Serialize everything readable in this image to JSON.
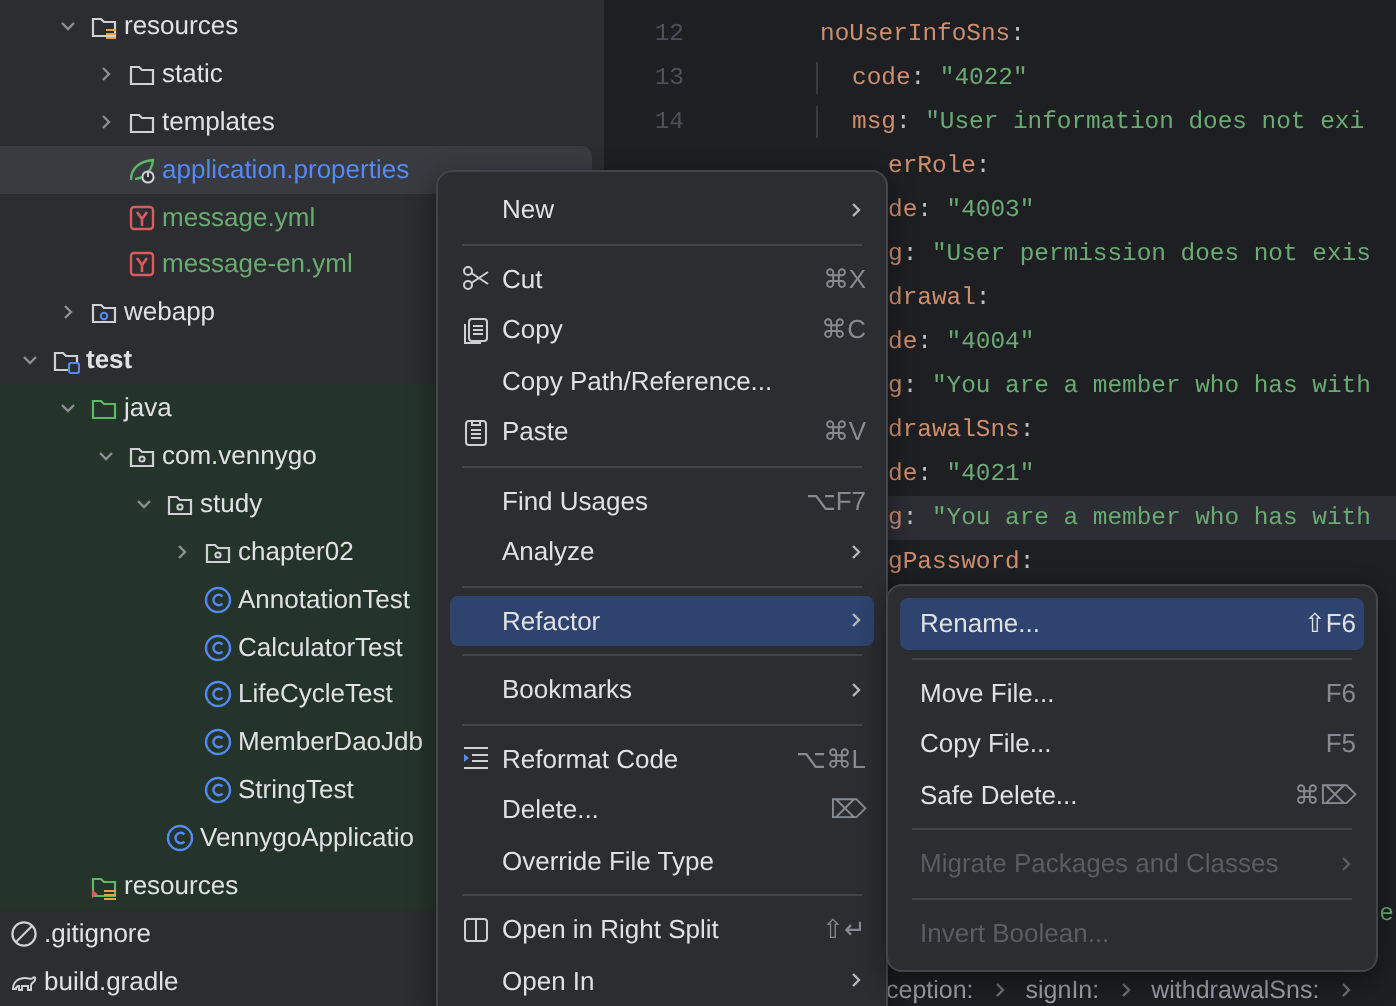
{
  "project_tree": [
    {
      "kind": "offscreen_parent",
      "children": [
        {
          "kind": "offscreen_parent",
          "children": [
            {
              "label": "resources",
              "kind": "resources_folder",
              "expanded": true,
              "selected": false,
              "children": [
                {
                  "label": "static",
                  "kind": "folder",
                  "expanded": false,
                  "selected": false
                },
                {
                  "label": "templates",
                  "kind": "folder",
                  "expanded": false,
                  "selected": false
                },
                {
                  "label": "application.properties",
                  "kind": "spring_config",
                  "color": "#548af7",
                  "selected": true
                },
                {
                  "label": "message.yml",
                  "kind": "yaml",
                  "color": "#6aab73",
                  "selected": false
                },
                {
                  "label": "message-en.yml",
                  "kind": "yaml",
                  "color": "#6aab73",
                  "selected": false
                }
              ]
            },
            {
              "label": "webapp",
              "kind": "web_folder",
              "expanded": false,
              "selected": false
            }
          ]
        },
        {
          "label": "test",
          "kind": "test_module",
          "expanded": true,
          "selected": false,
          "tint_children": true,
          "children": [
            {
              "label": "java",
              "kind": "test_source",
              "expanded": true,
              "selected": false,
              "children": [
                {
                  "label": "com.vennygo",
                  "kind": "package",
                  "expanded": true,
                  "selected": false,
                  "children": [
                    {
                      "label": "study",
                      "kind": "package",
                      "expanded": true,
                      "selected": false,
                      "children": [
                        {
                          "label": "chapter02",
                          "kind": "package",
                          "expanded": false,
                          "selected": false
                        },
                        {
                          "label": "AnnotationTest",
                          "kind": "class",
                          "selected": false
                        },
                        {
                          "label": "CalculatorTest",
                          "kind": "class",
                          "selected": false
                        },
                        {
                          "label": "LifeCycleTest",
                          "kind": "class",
                          "selected": false
                        },
                        {
                          "label": "MemberDaoJdb",
                          "kind": "class",
                          "selected": false
                        },
                        {
                          "label": "StringTest",
                          "kind": "class",
                          "selected": false
                        }
                      ]
                    },
                    {
                      "label": "VennygoApplicatio",
                      "kind": "class",
                      "selected": false
                    }
                  ]
                }
              ]
            },
            {
              "label": "resources",
              "kind": "test_resources",
              "selected": false
            }
          ]
        }
      ]
    },
    {
      "label": ".gitignore",
      "kind": "ignore",
      "selected": false
    },
    {
      "label": "build.gradle",
      "kind": "gradle",
      "selected": false
    }
  ],
  "editor": {
    "lines": [
      {
        "number": "12",
        "kind": "full",
        "indent": false,
        "current": false,
        "tokens": [
          {
            "kind": "key",
            "text": "noUserInfoSns"
          },
          {
            "kind": "punct",
            "text": ":"
          }
        ]
      },
      {
        "number": "13",
        "kind": "full",
        "indent": true,
        "current": false,
        "tokens": [
          {
            "kind": "key",
            "text": "code"
          },
          {
            "kind": "punct",
            "text": ": "
          },
          {
            "kind": "string",
            "text": "\"4022\""
          }
        ]
      },
      {
        "number": "14",
        "kind": "full",
        "indent": true,
        "current": false,
        "tokens": [
          {
            "kind": "key",
            "text": "msg"
          },
          {
            "kind": "punct",
            "text": ": "
          },
          {
            "kind": "string",
            "text": "\"User information does not exi"
          }
        ]
      },
      {
        "kind": "clipped",
        "current": false,
        "tokens": [
          {
            "kind": "key",
            "text": "erRole"
          },
          {
            "kind": "punct",
            "text": ":"
          }
        ]
      },
      {
        "kind": "clipped",
        "current": false,
        "tokens": [
          {
            "kind": "key",
            "text": "de"
          },
          {
            "kind": "punct",
            "text": ": "
          },
          {
            "kind": "string",
            "text": "\"4003\""
          }
        ]
      },
      {
        "kind": "clipped",
        "current": false,
        "tokens": [
          {
            "kind": "key",
            "text": "g"
          },
          {
            "kind": "punct",
            "text": ": "
          },
          {
            "kind": "string",
            "text": "\"User permission does not exis"
          }
        ]
      },
      {
        "kind": "clipped",
        "current": false,
        "tokens": [
          {
            "kind": "key",
            "text": "drawal"
          },
          {
            "kind": "punct",
            "text": ":"
          }
        ]
      },
      {
        "kind": "clipped",
        "current": false,
        "tokens": [
          {
            "kind": "key",
            "text": "de"
          },
          {
            "kind": "punct",
            "text": ": "
          },
          {
            "kind": "string",
            "text": "\"4004\""
          }
        ]
      },
      {
        "kind": "clipped",
        "current": false,
        "tokens": [
          {
            "kind": "key",
            "text": "g"
          },
          {
            "kind": "punct",
            "text": ": "
          },
          {
            "kind": "string",
            "text": "\"You are a member who has with"
          }
        ]
      },
      {
        "kind": "clipped",
        "current": false,
        "tokens": [
          {
            "kind": "key",
            "text": "drawalSns"
          },
          {
            "kind": "punct",
            "text": ":"
          }
        ]
      },
      {
        "kind": "clipped",
        "current": false,
        "tokens": [
          {
            "kind": "key",
            "text": "de"
          },
          {
            "kind": "punct",
            "text": ": "
          },
          {
            "kind": "string",
            "text": "\"4021\""
          }
        ]
      },
      {
        "kind": "clipped",
        "current": true,
        "tokens": [
          {
            "kind": "key",
            "text": "g"
          },
          {
            "kind": "punct",
            "text": ": "
          },
          {
            "kind": "string",
            "text": "\"You are a member who has with"
          }
        ]
      },
      {
        "kind": "clipped",
        "current": false,
        "tokens": [
          {
            "kind": "key",
            "text": "gPassword"
          },
          {
            "kind": "punct",
            "text": ":"
          }
        ]
      },
      {
        "kind": "covered"
      },
      {
        "kind": "covered"
      },
      {
        "kind": "covered"
      },
      {
        "kind": "covered"
      },
      {
        "kind": "covered"
      },
      {
        "kind": "covered"
      },
      {
        "kind": "covered"
      },
      {
        "kind": "tail",
        "current": false,
        "tokens": [
          {
            "kind": "string",
            "text": "e"
          }
        ]
      }
    ],
    "breadcrumbs": [
      "ception:",
      "signIn:",
      "withdrawalSns:"
    ]
  },
  "context_menu": [
    {
      "kind": "item",
      "label": "New",
      "submenu": true,
      "selected": false
    },
    {
      "kind": "separator"
    },
    {
      "kind": "cut",
      "label": "Cut",
      "shortcut": "⌘X",
      "selected": false
    },
    {
      "kind": "copy",
      "label": "Copy",
      "shortcut": "⌘C",
      "selected": false
    },
    {
      "kind": "item",
      "label": "Copy Path/Reference...",
      "selected": false
    },
    {
      "kind": "paste",
      "label": "Paste",
      "shortcut": "⌘V",
      "selected": false
    },
    {
      "kind": "separator"
    },
    {
      "kind": "item",
      "label": "Find Usages",
      "shortcut": "⌥F7",
      "selected": false
    },
    {
      "kind": "item",
      "label": "Analyze",
      "submenu": true,
      "selected": false
    },
    {
      "kind": "separator"
    },
    {
      "kind": "item",
      "label": "Refactor",
      "submenu": true,
      "selected": true
    },
    {
      "kind": "separator"
    },
    {
      "kind": "item",
      "label": "Bookmarks",
      "submenu": true,
      "selected": false
    },
    {
      "kind": "separator"
    },
    {
      "kind": "reformat",
      "label": "Reformat Code",
      "shortcut": "⌥⌘L",
      "selected": false
    },
    {
      "kind": "item",
      "label": "Delete...",
      "shortcut": "⌦",
      "selected": false
    },
    {
      "kind": "item",
      "label": "Override File Type",
      "selected": false
    },
    {
      "kind": "separator"
    },
    {
      "kind": "split",
      "label": "Open in Right Split",
      "shortcut": "⇧↵",
      "selected": false
    },
    {
      "kind": "item",
      "label": "Open In",
      "submenu": true,
      "selected": false
    }
  ],
  "refactor_submenu": [
    {
      "kind": "item",
      "label": "Rename...",
      "shortcut": "⇧F6",
      "selected": true,
      "disabled": false
    },
    {
      "kind": "separator"
    },
    {
      "kind": "item",
      "label": "Move File...",
      "shortcut": "F6",
      "selected": false,
      "disabled": false
    },
    {
      "kind": "item",
      "label": "Copy File...",
      "shortcut": "F5",
      "selected": false,
      "disabled": false
    },
    {
      "kind": "item",
      "label": "Safe Delete...",
      "shortcut": "⌘⌦",
      "selected": false,
      "disabled": false
    },
    {
      "kind": "separator"
    },
    {
      "kind": "item",
      "label": "Migrate Packages and Classes",
      "submenu": true,
      "selected": false,
      "disabled": true
    },
    {
      "kind": "separator"
    },
    {
      "kind": "item",
      "label": "Invert Boolean...",
      "selected": false,
      "disabled": true
    }
  ]
}
